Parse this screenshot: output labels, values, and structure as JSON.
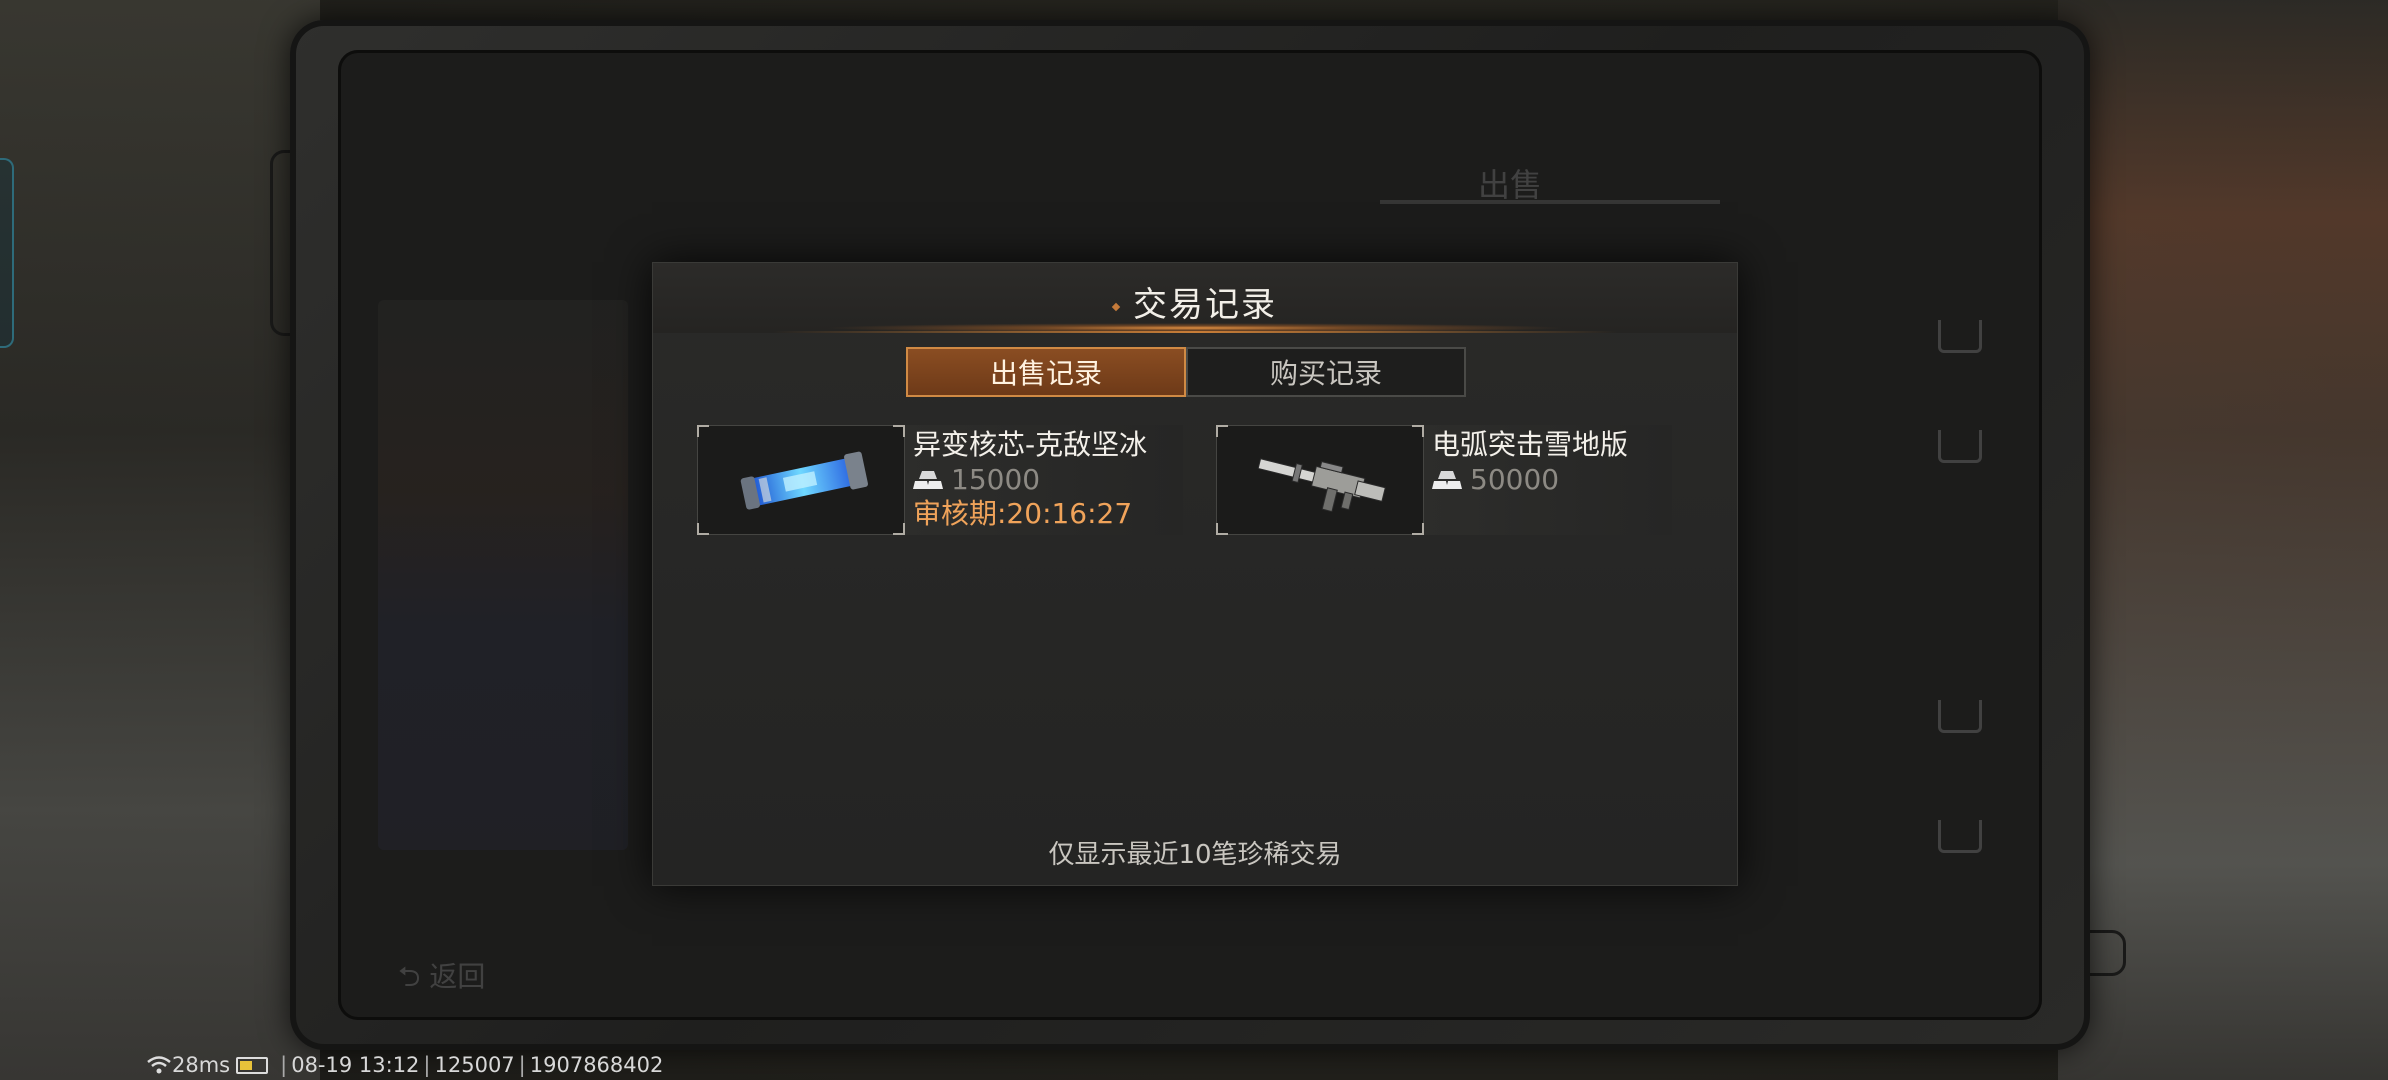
{
  "dialog": {
    "title": "交易记录",
    "tabs": [
      {
        "label": "出售记录",
        "active": true
      },
      {
        "label": "购买记录",
        "active": false
      }
    ],
    "records": [
      {
        "name": "异变核芯-克敌坚冰",
        "price": "15000",
        "review": "审核期:20:16:27",
        "thumb_icon": "energy-core-icon"
      },
      {
        "name": "电弧突击雪地版",
        "price": "50000",
        "review": "",
        "thumb_icon": "rifle-icon"
      }
    ],
    "footer_note": "仅显示最近10笔珍稀交易"
  },
  "background_screen": {
    "tab_sell": "出售",
    "back_label": "返回"
  },
  "statusbar": {
    "ping": "28ms",
    "datetime": "08-19 13:12",
    "server": "125007",
    "uid": "1907868402"
  },
  "colors": {
    "accent_orange": "#f0a35a",
    "tab_active": "#8a4d22"
  }
}
